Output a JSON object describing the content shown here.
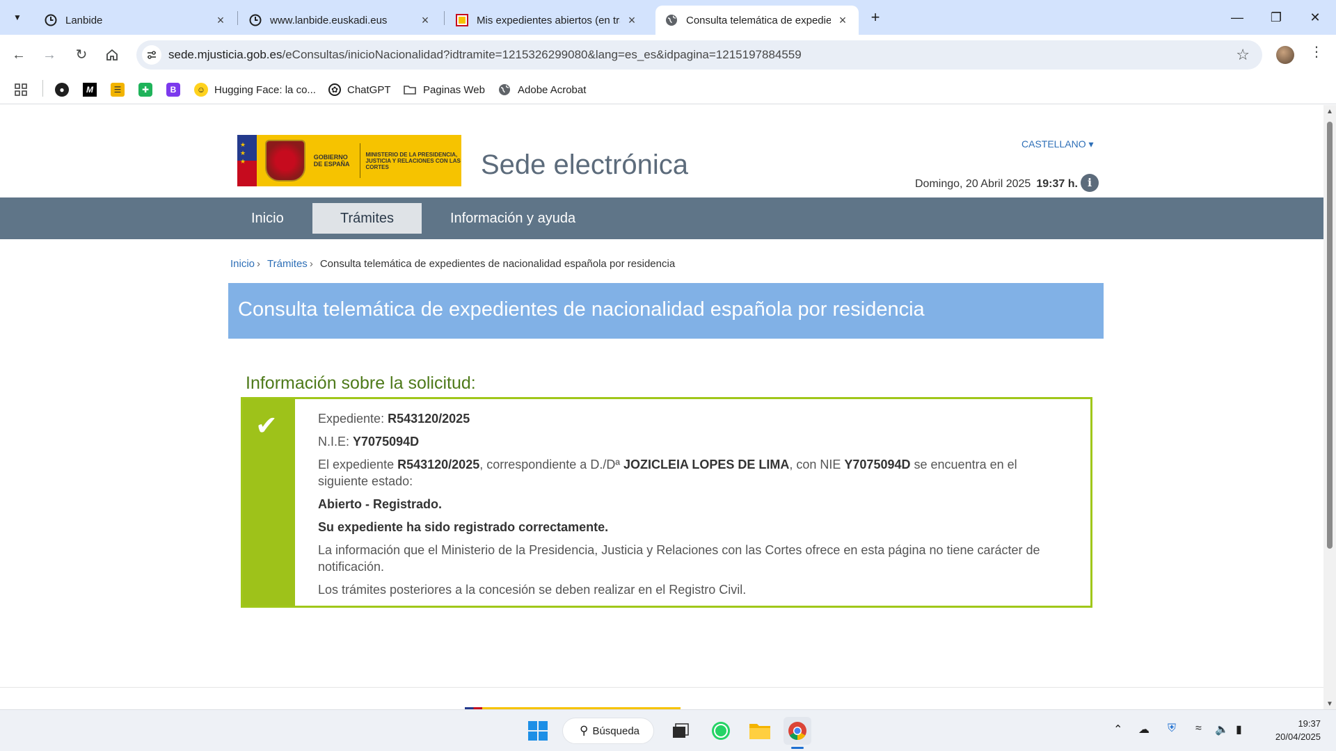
{
  "browser": {
    "tabs": [
      {
        "title": "Lanbide",
        "active": false
      },
      {
        "title": "www.lanbide.euskadi.eus",
        "active": false
      },
      {
        "title": "Mis expedientes abiertos (en trá",
        "active": false
      },
      {
        "title": "Consulta telemática de expedie",
        "active": true
      }
    ],
    "url_host": "sede.mjusticia.gob.es",
    "url_path": "/eConsultas/inicioNacionalidad?idtramite=1215326299080&lang=es_es&idpagina=1215197884559",
    "bookmarks": [
      {
        "label": "",
        "icon": "github-icon"
      },
      {
        "label": "M",
        "icon": "medium-icon"
      },
      {
        "label": "",
        "icon": "stack-icon"
      },
      {
        "label": "",
        "icon": "green-app-icon"
      },
      {
        "label": "B",
        "icon": "b-app-icon"
      },
      {
        "label": "Hugging Face: la co...",
        "icon": "hugging-face-icon"
      },
      {
        "label": "ChatGPT",
        "icon": "chatgpt-icon"
      },
      {
        "label": "Paginas Web",
        "icon": "folder-icon"
      },
      {
        "label": "Adobe Acrobat",
        "icon": "globe-icon"
      }
    ]
  },
  "site": {
    "logo_text_left": "GOBIERNO DE ESPAÑA",
    "logo_text_right": "MINISTERIO DE LA PRESIDENCIA, JUSTICIA Y RELACIONES CON LAS CORTES",
    "sede_title": "Sede electrónica",
    "language": "CASTELLANO ▾",
    "date": "Domingo, 20 Abril 2025",
    "time": "19:37 h.",
    "info_icon": "i",
    "nav": [
      "Inicio",
      "Trámites",
      "Información y ayuda"
    ],
    "nav_active": "Trámites",
    "breadcrumb": [
      "Inicio",
      "Trámites"
    ],
    "breadcrumb_current": "Consulta telemática de expedientes de nacionalidad española por residencia",
    "page_title": "Consulta telemática de expedientes de nacionalidad española por residencia"
  },
  "result": {
    "heading": "Información sobre la solicitud:",
    "expediente_label": "Expediente:",
    "expediente": "R543120/2025",
    "nie_label": "N.I.E:",
    "nie": "Y7075094D",
    "sentence_1": "El expediente",
    "sentence_2": ", correspondiente a D./Dª",
    "holder": "JOZICLEIA LOPES DE LIMA",
    "sentence_3": ", con NIE",
    "sentence_4": "se encuentra en el siguiente estado:",
    "status": "Abierto - Registrado.",
    "status_message": "Su expediente ha sido registrado correctamente.",
    "notice_1": "La información que el Ministerio de la Presidencia, Justicia y Relaciones con las Cortes ofrece en esta página no tiene carácter de notificación.",
    "notice_2": "Los trámites posteriores a la concesión se deben realizar en el Registro Civil."
  },
  "taskbar": {
    "search_label": "Búsqueda",
    "time": "19:37",
    "date": "20/04/2025"
  },
  "colors": {
    "nav_bg": "#5f7588",
    "title_band": "#81b1e6",
    "success_green": "#9ec21a",
    "heading_green": "#4e7a1a",
    "link_blue": "#2e6fb7"
  }
}
